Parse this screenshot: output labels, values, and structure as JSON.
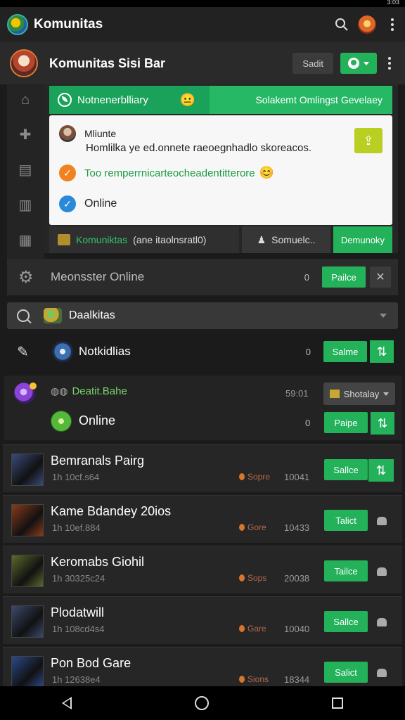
{
  "status_bar": {
    "time": "3:03"
  },
  "app_bar": {
    "title": "Komunitas"
  },
  "sub_header": {
    "title": "Komunitas Sisi Bar",
    "dark_button": "Sadit"
  },
  "banner": {
    "left_text": "Notnenerblliary",
    "right_text": "Solakemt Omlingst Gevelaey",
    "emoji": "😐"
  },
  "card": {
    "title": "Mliunte",
    "description": "Homlilka ye ed.onnete raeoegnhadlo skoreacos.",
    "green_text": "Too remperrnicarteocheadentitterore",
    "green_emoji": "😊",
    "online_label": "Online"
  },
  "tabs": {
    "tab_a_green": "Komuniktas",
    "tab_a_white": "(ane itaolnsratl0)",
    "tab_b": "Somuelc..",
    "tab_c": "Demunoky"
  },
  "settings_row": {
    "label": "Meonsster Online",
    "count": "0",
    "button": "Pailce"
  },
  "search_row": {
    "text": "Daalkitas"
  },
  "notification_row": {
    "text": "Notkidlias",
    "count": "0",
    "button": "Salme"
  },
  "online_block": {
    "title": "Deatit.Bahe",
    "time": "59:01",
    "dropdown": "Shotalay",
    "online": "Online",
    "count": "0",
    "button": "Paipe"
  },
  "games": [
    {
      "name": "Bemranals Pairg",
      "sub": "1h 10cf.s64",
      "tag": "Sopre",
      "num": "10041",
      "button": "Sallce",
      "action": "plus",
      "thumb": "#3a4a7a"
    },
    {
      "name": "Kame Bdandey 20ios",
      "sub": "1h 10ef.884",
      "tag": "Gore",
      "num": "10433",
      "button": "Talict",
      "action": "lock",
      "thumb": "#8a3a1a"
    },
    {
      "name": "Keromabs Giohil",
      "sub": "1h 30325c24",
      "tag": "Sops",
      "num": "20038",
      "button": "Tailce",
      "action": "lock",
      "thumb": "#5a6a2a"
    },
    {
      "name": "Plodatwill",
      "sub": "1h 108cd4s4",
      "tag": "Gare",
      "num": "10040",
      "button": "Sallce",
      "action": "lock",
      "thumb": "#3a4a6a"
    },
    {
      "name": "Pon Bod Gare",
      "sub": "1h 12638e4",
      "tag": "Sions",
      "num": "18344",
      "button": "Salict",
      "action": "lock",
      "thumb": "#2a4a8a"
    }
  ]
}
